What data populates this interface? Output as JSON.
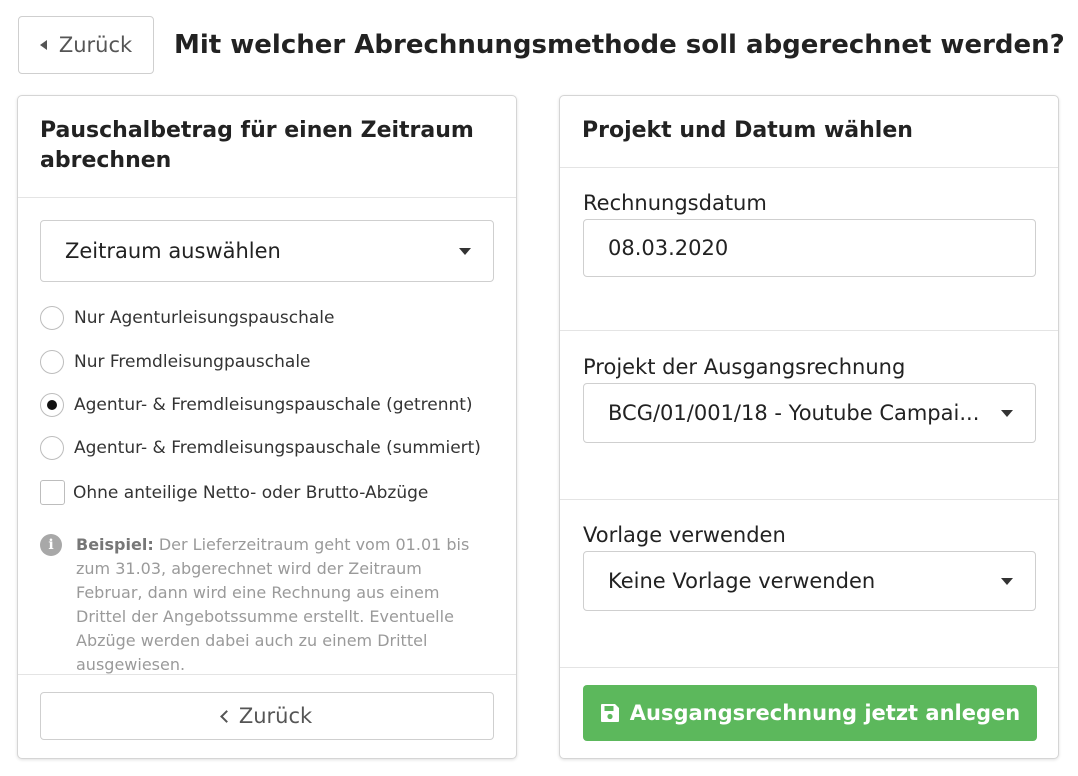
{
  "header": {
    "back_label": "Zurück",
    "title": "Mit welcher Abrechnungsmethode soll abgerechnet werden?"
  },
  "left_panel": {
    "title": "Pauschalbetrag für einen Zeitraum abrechnen",
    "period_select": {
      "value": "Zeitraum auswählen",
      "icon": "caret-down-icon"
    },
    "options": [
      {
        "label": "Nur Agenturleisungspauschale",
        "checked": false
      },
      {
        "label": "Nur Fremdleisungpauschale",
        "checked": false
      },
      {
        "label": "Agentur- & Fremdleisungspauschale (getrennt)",
        "checked": true
      },
      {
        "label": "Agentur- & Fremdleisungspauschale (summiert)",
        "checked": false
      }
    ],
    "checkbox": {
      "label": "Ohne anteilige Netto- oder Brutto-Abzüge",
      "checked": false
    },
    "info": {
      "icon": "info-icon",
      "label": "Beispiel:",
      "text": "Der Lieferzeitraum geht vom 01.01 bis zum 31.03, abgerechnet wird der Zeitraum Februar, dann wird eine Rechnung aus einem Drittel der Angebotssumme erstellt. Eventuelle Abzüge werden dabei auch zu einem Drittel ausgewiesen."
    },
    "back_label": "Zurück"
  },
  "right_panel": {
    "title": "Projekt und Datum wählen",
    "invoice_date": {
      "label": "Rechnungsdatum",
      "value": "08.03.2020"
    },
    "project": {
      "label": "Projekt der Ausgangsrechnung",
      "value": "BCG/01/001/18 - Youtube Campai..."
    },
    "template": {
      "label": "Vorlage verwenden",
      "value": "Keine Vorlage verwenden"
    },
    "create_button": {
      "label": "Ausgangsrechnung jetzt anlegen",
      "icon": "save-icon"
    }
  },
  "colors": {
    "primary_button": "#5cb85c",
    "border": "#cfcfcf",
    "muted_text": "#9a9a9a"
  }
}
